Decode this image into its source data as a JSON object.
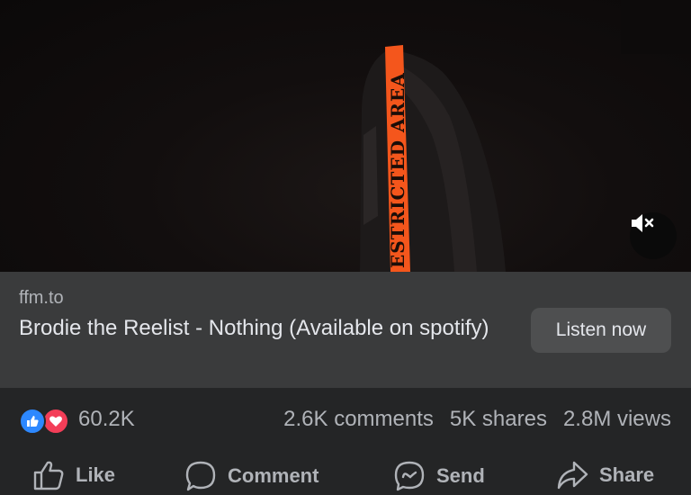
{
  "video": {
    "strap_text": "ESTRICTED AREA",
    "mute_icon": "speaker-muted-icon"
  },
  "link_preview": {
    "domain": "ffm.to",
    "title": "Brodie the Reelist - Nothing (Available on spotify)",
    "cta_label": "Listen now"
  },
  "stats": {
    "reaction_icons": [
      "like-reaction-icon",
      "love-reaction-icon"
    ],
    "reaction_count": "60.2K",
    "comments": "2.6K comments",
    "shares": "5K shares",
    "views": "2.8M views"
  },
  "actions": {
    "like": "Like",
    "comment": "Comment",
    "send": "Send",
    "share": "Share"
  },
  "colors": {
    "background": "#242526",
    "card": "#3a3b3c",
    "secondary_text": "#b0b3b8",
    "primary_text": "#e4e6eb",
    "strap": "#f4561c",
    "like_blue": "#2d88ff",
    "love_red": "#f33e58"
  }
}
